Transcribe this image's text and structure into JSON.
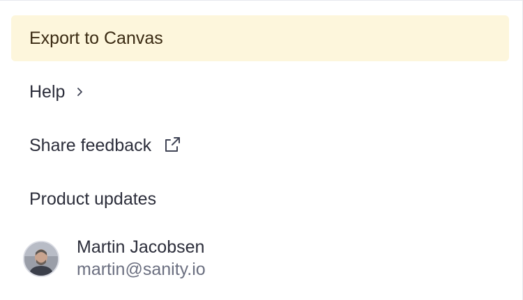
{
  "menu": {
    "items": [
      {
        "label": "Export to Canvas",
        "icon": null
      },
      {
        "label": "Help",
        "icon": "chevron-right-icon"
      },
      {
        "label": "Share feedback",
        "icon": "external-link-icon"
      },
      {
        "label": "Product updates",
        "icon": null
      }
    ]
  },
  "user": {
    "name": "Martin Jacobsen",
    "email": "martin@sanity.io",
    "avatar": "avatar-photo"
  },
  "colors": {
    "highlight_bg": "#fdf6dc",
    "text": "#2b2d3a",
    "muted_text": "#6b6f80"
  }
}
